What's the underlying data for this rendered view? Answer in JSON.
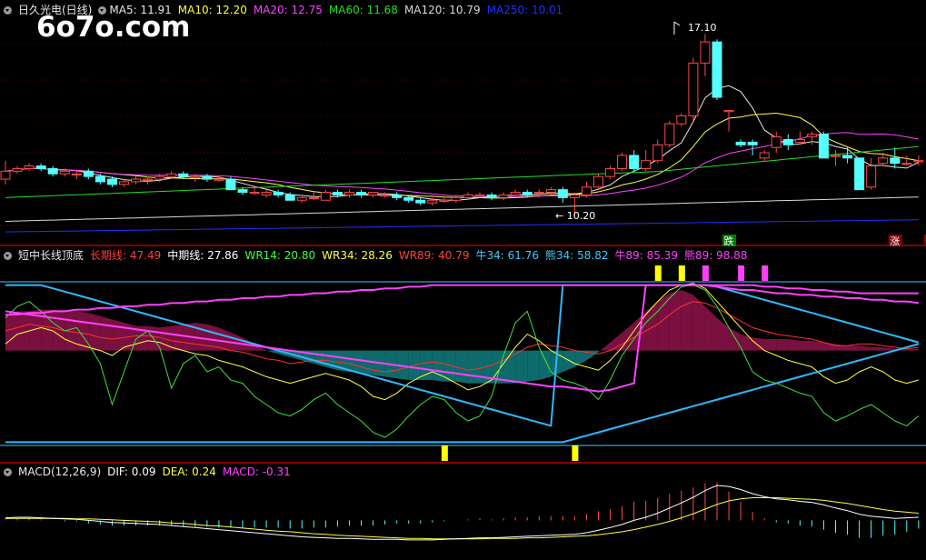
{
  "watermark": "6o7o.com",
  "main_panel": {
    "title": "日久光电(日线)",
    "ma": [
      {
        "label": "MA5: 11.91",
        "color": "#e6e6e6"
      },
      {
        "label": "MA10: 12.20",
        "color": "#ffff40"
      },
      {
        "label": "MA20: 12.75",
        "color": "#ff40ff"
      },
      {
        "label": "MA60: 11.68",
        "color": "#20e020"
      },
      {
        "label": "MA120: 10.79",
        "color": "#d8d8d8"
      },
      {
        "label": "MA250: 10.01",
        "color": "#2030ff"
      }
    ],
    "high_label": "17.10",
    "low_label": "10.20",
    "signals": [
      {
        "text": "跌",
        "bg": "#007a00",
        "color": "#ffffff",
        "bar": 61
      },
      {
        "text": "涨",
        "bg": "#8a0000",
        "color": "#ffffff",
        "bar": 75
      },
      {
        "text": "预",
        "bg": "#8a0000",
        "color": "#ffd24a",
        "bar": 78
      }
    ]
  },
  "indicator_panel": {
    "title": "短中长线顶底",
    "items": [
      {
        "label": "长期线: 47.49",
        "color": "#ff4040"
      },
      {
        "label": "中期线: 27.86",
        "color": "#ffffff"
      },
      {
        "label": "WR14: 20.80",
        "color": "#40ff40"
      },
      {
        "label": "WR34: 28.26",
        "color": "#ffff40"
      },
      {
        "label": "WR89: 40.79",
        "color": "#ff4040"
      },
      {
        "label": "牛34: 61.76",
        "color": "#40c8ff"
      },
      {
        "label": "熊34: 58.82",
        "color": "#40c8ff"
      },
      {
        "label": "牛89: 85.39",
        "color": "#ff40ff"
      },
      {
        "label": "熊89: 98.88",
        "color": "#ff40ff"
      }
    ]
  },
  "macd_panel": {
    "title": "MACD(12,26,9)",
    "items": [
      {
        "label": "DIF: 0.09",
        "color": "#ffffff"
      },
      {
        "label": "DEA: 0.24",
        "color": "#ffff40"
      },
      {
        "label": "MACD: -0.31",
        "color": "#ff40ff"
      }
    ]
  },
  "chart_data": [
    {
      "type": "candlestick",
      "title": "日久光电(日线)",
      "ylim": [
        9.5,
        17.7
      ],
      "ohlc": [
        [
          11.6,
          11.9,
          11.4,
          12.3
        ],
        [
          11.9,
          12.0,
          11.8,
          12.1
        ],
        [
          12.0,
          12.1,
          11.9,
          12.2
        ],
        [
          12.1,
          12.0,
          11.9,
          12.2
        ],
        [
          12.0,
          11.8,
          11.7,
          12.1
        ],
        [
          11.8,
          11.9,
          11.7,
          12.0
        ],
        [
          11.8,
          11.8,
          11.6,
          11.9
        ],
        [
          11.9,
          11.7,
          11.6,
          12.0
        ],
        [
          11.7,
          11.5,
          11.4,
          11.8
        ],
        [
          11.6,
          11.4,
          11.3,
          11.7
        ],
        [
          11.4,
          11.5,
          11.3,
          11.6
        ],
        [
          11.5,
          11.6,
          11.4,
          11.7
        ],
        [
          11.6,
          11.6,
          11.4,
          11.7
        ],
        [
          11.6,
          11.7,
          11.5,
          11.8
        ],
        [
          11.7,
          11.8,
          11.6,
          11.9
        ],
        [
          11.8,
          11.7,
          11.6,
          11.9
        ],
        [
          11.7,
          11.7,
          11.5,
          11.8
        ],
        [
          11.7,
          11.6,
          11.5,
          11.8
        ],
        [
          11.6,
          11.6,
          11.5,
          11.7
        ],
        [
          11.6,
          11.2,
          11.2,
          11.7
        ],
        [
          11.2,
          11.1,
          11.0,
          11.3
        ],
        [
          11.1,
          11.1,
          11.0,
          11.3
        ],
        [
          11.0,
          11.1,
          10.9,
          11.2
        ],
        [
          11.1,
          11.0,
          10.9,
          11.2
        ],
        [
          11.0,
          10.8,
          10.8,
          11.1
        ],
        [
          10.8,
          10.9,
          10.7,
          11.0
        ],
        [
          10.9,
          10.9,
          10.8,
          11.1
        ],
        [
          10.8,
          11.1,
          10.8,
          11.2
        ],
        [
          11.1,
          11.0,
          10.9,
          11.2
        ],
        [
          11.0,
          11.1,
          10.9,
          11.2
        ],
        [
          11.1,
          11.0,
          10.9,
          11.2
        ],
        [
          11.0,
          11.1,
          10.9,
          11.1
        ],
        [
          11.0,
          11.0,
          10.9,
          11.1
        ],
        [
          11.0,
          10.9,
          10.8,
          11.1
        ],
        [
          10.9,
          10.8,
          10.7,
          11.0
        ],
        [
          10.8,
          10.7,
          10.6,
          10.9
        ],
        [
          10.7,
          10.8,
          10.6,
          10.9
        ],
        [
          10.8,
          10.8,
          10.7,
          10.9
        ],
        [
          10.8,
          10.9,
          10.7,
          11.0
        ],
        [
          10.9,
          11.0,
          10.8,
          11.1
        ],
        [
          11.0,
          11.0,
          10.9,
          11.1
        ],
        [
          11.0,
          10.9,
          10.8,
          11.1
        ],
        [
          10.9,
          11.0,
          10.8,
          11.1
        ],
        [
          11.0,
          11.1,
          10.9,
          11.2
        ],
        [
          11.1,
          11.0,
          10.9,
          11.2
        ],
        [
          11.1,
          11.1,
          10.9,
          11.2
        ],
        [
          11.1,
          11.2,
          11.0,
          11.3
        ],
        [
          11.2,
          10.9,
          10.7,
          11.3
        ],
        [
          10.9,
          11.0,
          10.2,
          11.1
        ],
        [
          11.0,
          11.3,
          10.9,
          11.5
        ],
        [
          11.3,
          11.7,
          11.2,
          11.8
        ],
        [
          11.7,
          12.0,
          11.6,
          12.1
        ],
        [
          12.0,
          12.5,
          11.9,
          12.6
        ],
        [
          12.5,
          12.0,
          11.9,
          12.7
        ],
        [
          12.0,
          12.3,
          11.9,
          12.7
        ],
        [
          12.3,
          12.9,
          12.2,
          13.1
        ],
        [
          12.9,
          13.7,
          12.8,
          13.8
        ],
        [
          13.7,
          14.0,
          13.6,
          14.1
        ],
        [
          14.0,
          16.0,
          13.8,
          16.2
        ],
        [
          16.0,
          16.8,
          15.5,
          17.1
        ],
        [
          16.8,
          14.7,
          14.6,
          16.9
        ],
        [
          14.2,
          14.2,
          13.4,
          14.2
        ],
        [
          13.0,
          12.9,
          12.8,
          13.1
        ],
        [
          13.0,
          12.9,
          12.5,
          13.1
        ],
        [
          12.4,
          12.6,
          12.3,
          12.7
        ],
        [
          12.8,
          13.2,
          12.6,
          13.4
        ],
        [
          13.1,
          12.9,
          12.7,
          13.3
        ],
        [
          13.0,
          13.1,
          12.9,
          13.4
        ],
        [
          13.2,
          13.3,
          12.9,
          13.4
        ],
        [
          13.3,
          12.4,
          12.4,
          13.4
        ],
        [
          12.5,
          12.5,
          12.1,
          12.7
        ],
        [
          12.5,
          12.4,
          12.2,
          12.8
        ],
        [
          12.4,
          11.2,
          11.2,
          12.4
        ],
        [
          11.3,
          12.1,
          11.2,
          12.4
        ],
        [
          12.2,
          12.4,
          12.1,
          12.6
        ],
        [
          12.4,
          12.2,
          12.0,
          12.8
        ],
        [
          12.2,
          12.2,
          12.1,
          12.5
        ],
        [
          12.3,
          12.3,
          12.1,
          12.5
        ]
      ],
      "ma_lines": [
        "MA5",
        "MA10",
        "MA20",
        "MA60",
        "MA120",
        "MA250"
      ]
    },
    {
      "type": "line",
      "title": "短中长线顶底",
      "ylim": [
        0,
        100
      ],
      "area_index": [
        80,
        82,
        82,
        83,
        83,
        82,
        82,
        81,
        79,
        77,
        75,
        73,
        73,
        72,
        73,
        74,
        75,
        74,
        72,
        69,
        66,
        62,
        58,
        56,
        54,
        52,
        50,
        48,
        46,
        45,
        44,
        43,
        42,
        41,
        40,
        40,
        40,
        39,
        39,
        38,
        38,
        38,
        38,
        38,
        39,
        40,
        42,
        45,
        48,
        52,
        57,
        63,
        69,
        75,
        82,
        88,
        93,
        95,
        92,
        85,
        78,
        72,
        68,
        66,
        65,
        65,
        65,
        64,
        64,
        63,
        62,
        61,
        61,
        60,
        60,
        59,
        59,
        59
      ],
      "wr14": [
        78,
        85,
        88,
        82,
        75,
        70,
        72,
        62,
        50,
        25,
        45,
        65,
        70,
        60,
        35,
        50,
        55,
        45,
        48,
        40,
        38,
        30,
        25,
        20,
        18,
        22,
        28,
        32,
        25,
        20,
        15,
        8,
        5,
        10,
        18,
        25,
        30,
        28,
        20,
        15,
        18,
        30,
        55,
        75,
        82,
        60,
        45,
        40,
        38,
        35,
        28,
        40,
        55,
        65,
        75,
        82,
        90,
        97,
        98,
        95,
        85,
        72,
        60,
        45,
        40,
        38,
        35,
        32,
        30,
        20,
        15,
        18,
        22,
        25,
        20,
        15,
        12,
        18
      ],
      "wr34": [
        62,
        68,
        70,
        72,
        70,
        65,
        62,
        60,
        58,
        55,
        60,
        62,
        64,
        63,
        60,
        58,
        56,
        55,
        52,
        50,
        48,
        45,
        42,
        40,
        38,
        40,
        42,
        44,
        42,
        40,
        36,
        30,
        28,
        32,
        38,
        42,
        45,
        42,
        38,
        34,
        36,
        40,
        50,
        60,
        68,
        64,
        58,
        54,
        50,
        48,
        46,
        52,
        60,
        70,
        80,
        88,
        95,
        98,
        99,
        96,
        88,
        80,
        72,
        64,
        58,
        55,
        52,
        50,
        48,
        42,
        38,
        40,
        45,
        48,
        45,
        40,
        38,
        40
      ],
      "wr89": [
        70,
        72,
        74,
        73,
        72,
        70,
        69,
        68,
        66,
        65,
        66,
        67,
        67,
        66,
        64,
        63,
        62,
        61,
        60,
        58,
        57,
        55,
        53,
        52,
        50,
        51,
        52,
        52,
        51,
        50,
        48,
        46,
        45,
        46,
        48,
        50,
        51,
        50,
        48,
        46,
        47,
        49,
        52,
        56,
        60,
        62,
        61,
        60,
        58,
        57,
        56,
        58,
        62,
        66,
        70,
        74,
        80,
        85,
        88,
        87,
        84,
        80,
        76,
        72,
        70,
        68,
        67,
        66,
        65,
        63,
        61,
        61,
        62,
        62,
        61,
        60,
        59,
        60
      ],
      "bull34": [
        98,
        98,
        98,
        98,
        96,
        94,
        92,
        90,
        88,
        86,
        84,
        82,
        80,
        78,
        76,
        74,
        72,
        70,
        68,
        66,
        64,
        62,
        60,
        58,
        56,
        54,
        52,
        50,
        48,
        46,
        44,
        42,
        40,
        38,
        36,
        34,
        32,
        30,
        28,
        26,
        24,
        22,
        20,
        18,
        16,
        14,
        12,
        98,
        98,
        98,
        98,
        98,
        98,
        98,
        98,
        98,
        98,
        98,
        98,
        98,
        97,
        95,
        93,
        91,
        89,
        87,
        85,
        83,
        81,
        79,
        77,
        75,
        73,
        71,
        69,
        67,
        65,
        63
      ],
      "bear34": [
        2,
        2,
        2,
        2,
        2,
        2,
        2,
        2,
        2,
        2,
        2,
        2,
        2,
        2,
        2,
        2,
        2,
        2,
        2,
        2,
        2,
        2,
        2,
        2,
        2,
        2,
        2,
        2,
        2,
        2,
        2,
        2,
        2,
        2,
        2,
        2,
        2,
        2,
        2,
        2,
        2,
        2,
        2,
        2,
        2,
        2,
        2,
        2,
        4,
        6,
        8,
        10,
        12,
        14,
        16,
        18,
        20,
        22,
        24,
        26,
        28,
        30,
        32,
        34,
        36,
        38,
        40,
        42,
        44,
        46,
        48,
        50,
        52,
        54,
        56,
        58,
        60,
        62
      ],
      "bull89": [
        82,
        81,
        80,
        79,
        78,
        77,
        76,
        75,
        74,
        73,
        72,
        71,
        70,
        69,
        68,
        67,
        66,
        65,
        64,
        63,
        62,
        61,
        60,
        59,
        58,
        57,
        56,
        55,
        54,
        53,
        52,
        51,
        50,
        49,
        48,
        47,
        46,
        45,
        44,
        43,
        42,
        41,
        40,
        39,
        38,
        37,
        36,
        36,
        35,
        34,
        33,
        34,
        36,
        38,
        98,
        98,
        98,
        98,
        98,
        98,
        97,
        96,
        95,
        95,
        94,
        93,
        93,
        92,
        92,
        91,
        91,
        90,
        90,
        89,
        89,
        88,
        88,
        87
      ],
      "bear89": [
        80,
        80,
        81,
        81,
        82,
        82,
        83,
        83,
        84,
        84,
        85,
        85,
        86,
        86,
        87,
        87,
        88,
        88,
        89,
        89,
        90,
        90,
        91,
        91,
        92,
        92,
        93,
        93,
        94,
        94,
        95,
        95,
        96,
        96,
        97,
        97,
        98,
        98,
        98,
        98,
        98,
        98,
        98,
        98,
        98,
        98,
        98,
        98,
        98,
        98,
        98,
        98,
        98,
        98,
        98,
        98,
        98,
        98,
        98,
        98,
        98,
        98,
        98,
        98,
        97,
        97,
        96,
        96,
        95,
        95,
        94,
        94,
        93,
        93,
        93,
        93,
        93,
        93
      ],
      "top_markers": [
        55,
        57,
        59,
        62,
        64
      ],
      "bottom_markers": [
        37,
        48
      ]
    },
    {
      "type": "macd",
      "title": "MACD(12,26,9)",
      "ylim": [
        -0.7,
        0.75
      ],
      "dif": [
        0.05,
        0.06,
        0.06,
        0.05,
        0.04,
        0.03,
        0.02,
        0.0,
        -0.02,
        -0.04,
        -0.05,
        -0.06,
        -0.07,
        -0.08,
        -0.1,
        -0.12,
        -0.14,
        -0.16,
        -0.18,
        -0.2,
        -0.22,
        -0.24,
        -0.26,
        -0.28,
        -0.3,
        -0.32,
        -0.33,
        -0.34,
        -0.35,
        -0.35,
        -0.36,
        -0.37,
        -0.37,
        -0.37,
        -0.38,
        -0.38,
        -0.38,
        -0.37,
        -0.36,
        -0.35,
        -0.34,
        -0.34,
        -0.33,
        -0.32,
        -0.31,
        -0.3,
        -0.29,
        -0.28,
        -0.27,
        -0.24,
        -0.19,
        -0.14,
        -0.08,
        0.0,
        0.06,
        0.14,
        0.24,
        0.34,
        0.45,
        0.58,
        0.68,
        0.66,
        0.6,
        0.52,
        0.46,
        0.42,
        0.4,
        0.37,
        0.35,
        0.3,
        0.24,
        0.19,
        0.12,
        0.08,
        0.06,
        0.04,
        0.05,
        0.06
      ],
      "dea": [
        0.04,
        0.04,
        0.04,
        0.04,
        0.04,
        0.04,
        0.03,
        0.03,
        0.02,
        0.01,
        0.0,
        -0.01,
        -0.02,
        -0.03,
        -0.05,
        -0.06,
        -0.08,
        -0.1,
        -0.11,
        -0.13,
        -0.15,
        -0.17,
        -0.19,
        -0.21,
        -0.22,
        -0.24,
        -0.26,
        -0.27,
        -0.29,
        -0.3,
        -0.31,
        -0.32,
        -0.33,
        -0.34,
        -0.35,
        -0.35,
        -0.36,
        -0.36,
        -0.36,
        -0.36,
        -0.36,
        -0.35,
        -0.35,
        -0.35,
        -0.34,
        -0.34,
        -0.33,
        -0.32,
        -0.31,
        -0.3,
        -0.28,
        -0.25,
        -0.22,
        -0.18,
        -0.13,
        -0.08,
        -0.02,
        0.05,
        0.13,
        0.22,
        0.31,
        0.38,
        0.42,
        0.44,
        0.44,
        0.44,
        0.43,
        0.42,
        0.41,
        0.39,
        0.36,
        0.33,
        0.29,
        0.25,
        0.21,
        0.18,
        0.16,
        0.14
      ]
    }
  ]
}
